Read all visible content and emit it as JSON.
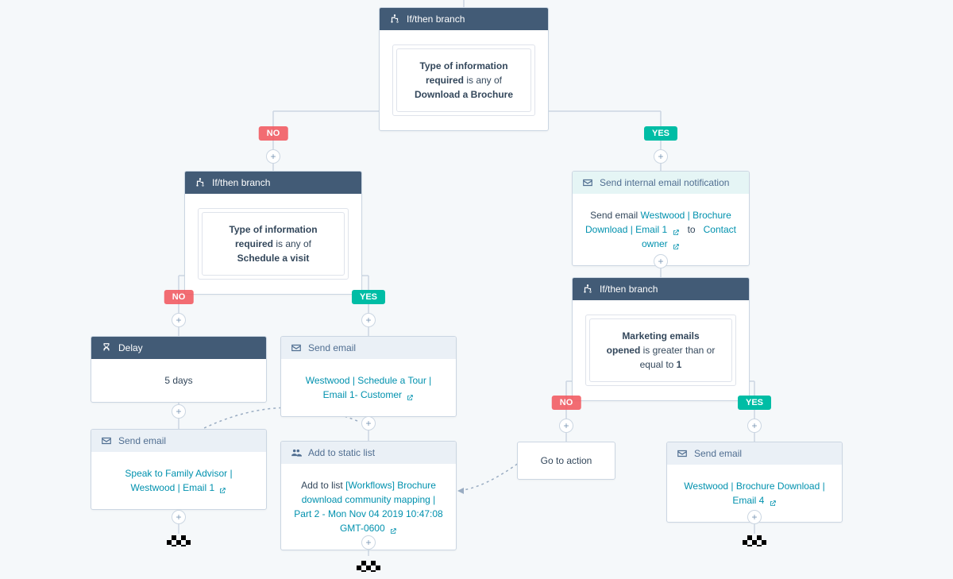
{
  "labels": {
    "if_then_branch": "If/then branch",
    "send_email": "Send email",
    "send_internal_email": "Send internal email notification",
    "delay": "Delay",
    "add_to_static_list": "Add to static list",
    "go_to_action": "Go to action",
    "yes": "YES",
    "no": "NO"
  },
  "root_branch": {
    "condition_prop": "Type of information required",
    "condition_mid": "is any of",
    "condition_value": "Download a Brochure"
  },
  "left": {
    "branch": {
      "condition_prop": "Type of information required",
      "condition_mid": "is any of",
      "condition_value": "Schedule a visit"
    },
    "no_path": {
      "delay_value": "5 days",
      "email_link": "Speak to Family Advisor | Westwood | Email 1"
    },
    "yes_path": {
      "email_link": "Westwood | Schedule a Tour | Email 1- Customer",
      "list_prefix": "Add to list",
      "list_link": "[Workflows] Brochure download community mapping | Part 2 - Mon Nov 04 2019 10:47:08 GMT-0600"
    }
  },
  "right": {
    "internal_email": {
      "prefix": "Send email",
      "link1": "Westwood | Brochure Download | Email 1",
      "to_word": "to",
      "link2": "Contact owner"
    },
    "branch": {
      "condition_prop": "Marketing emails opened",
      "condition_mid": "is greater than or equal to",
      "condition_value": "1"
    },
    "yes_path": {
      "email_link": "Westwood | Brochure Download | Email 4"
    }
  }
}
